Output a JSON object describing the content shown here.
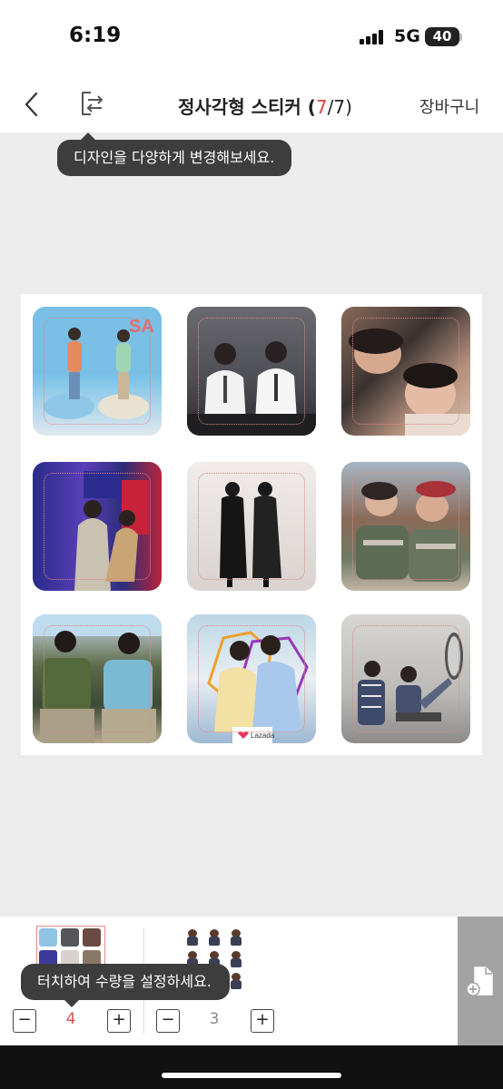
{
  "status_bar": {
    "time": "6:19",
    "network": "5G",
    "battery": "40"
  },
  "header": {
    "title_main": "정사각형 스티커 (",
    "title_current": "7",
    "title_total": "/7)",
    "cart_label": "장바구니",
    "back_icon": "chevron-left-icon",
    "change_design_icon": "swap-document-icon"
  },
  "tooltips": {
    "design_hint": "디자인을 다양하게 변경해보세요.",
    "quantity_hint": "터치하여 수량을 설정하세요."
  },
  "sticker_sheet": {
    "columns": 3,
    "rows": 3,
    "stickers": [
      {
        "id": "photo-1"
      },
      {
        "id": "photo-2"
      },
      {
        "id": "photo-3"
      },
      {
        "id": "photo-4"
      },
      {
        "id": "photo-5"
      },
      {
        "id": "photo-6"
      },
      {
        "id": "photo-7"
      },
      {
        "id": "photo-8"
      },
      {
        "id": "photo-9"
      }
    ],
    "sticker8_badge": "Lazada"
  },
  "designs": [
    {
      "minus": "−",
      "quantity": "4",
      "plus": "+",
      "selected": true
    },
    {
      "minus": "−",
      "quantity": "3",
      "plus": "+",
      "selected": false
    }
  ],
  "colors": {
    "accent": "#e0463e",
    "tooltip_bg": "#3d3d3d",
    "canvas_bg": "#ececec"
  }
}
